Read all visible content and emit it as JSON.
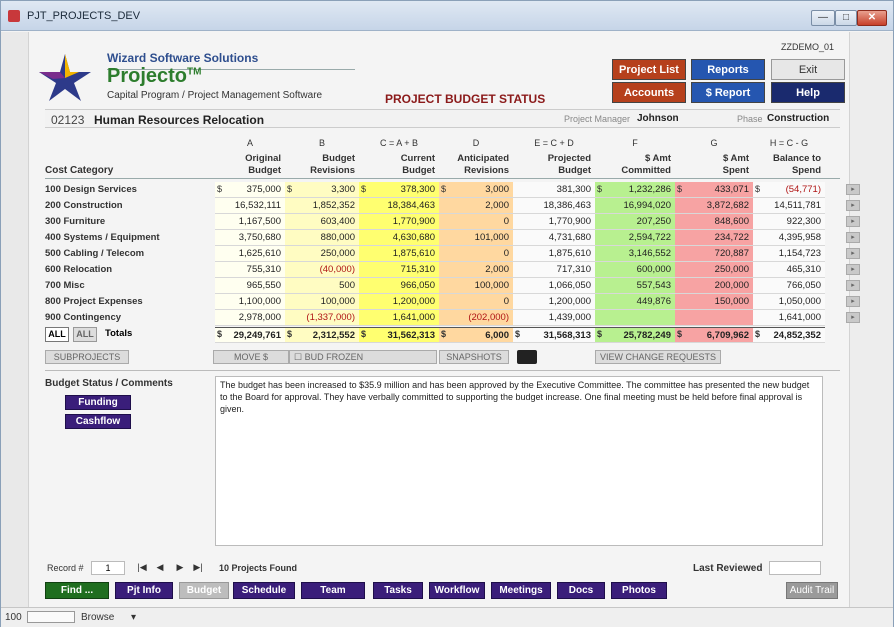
{
  "window": {
    "title": "PJT_PROJECTS_DEV"
  },
  "header": {
    "company": "Wizard Software Solutions",
    "brand": "Projecto",
    "brand_tm": "TM",
    "tagline": "Capital Program / Project Management Software",
    "page_title": "PROJECT BUDGET STATUS",
    "db_label": "ZZDEMO_01"
  },
  "nav": {
    "project_list": "Project List",
    "reports": "Reports",
    "exit": "Exit",
    "accounts": "Accounts",
    "s_report": "$ Report",
    "help": "Help"
  },
  "project": {
    "number": "02123",
    "name": "Human Resources Relocation",
    "pm_label": "Project Manager",
    "pm": "Johnson",
    "phase_label": "Phase",
    "phase": "Construction"
  },
  "columns": {
    "letters": [
      "A",
      "B",
      "C = A + B",
      "D",
      "E = C + D",
      "F",
      "G",
      "H = C - G"
    ],
    "headers": [
      [
        "Original",
        "Budget"
      ],
      [
        "Budget",
        "Revisions"
      ],
      [
        "Current",
        "Budget"
      ],
      [
        "Anticipated",
        "Revisions"
      ],
      [
        "Projected",
        "Budget"
      ],
      [
        "$ Amt",
        "Committed"
      ],
      [
        "$ Amt",
        "Spent"
      ],
      [
        "Balance to",
        "Spend"
      ]
    ],
    "cost_category": "Cost Category"
  },
  "rows": [
    {
      "cat": "100 Design Services",
      "a": "375,000",
      "b": "3,300",
      "c": "378,300",
      "d": "3,000",
      "e": "381,300",
      "f": "1,232,286",
      "g": "433,071",
      "h": "(54,771)"
    },
    {
      "cat": "200 Construction",
      "a": "16,532,111",
      "b": "1,852,352",
      "c": "18,384,463",
      "d": "2,000",
      "e": "18,386,463",
      "f": "16,994,020",
      "g": "3,872,682",
      "h": "14,511,781"
    },
    {
      "cat": "300 Furniture",
      "a": "1,167,500",
      "b": "603,400",
      "c": "1,770,900",
      "d": "0",
      "e": "1,770,900",
      "f": "207,250",
      "g": "848,600",
      "h": "922,300"
    },
    {
      "cat": "400 Systems / Equipment",
      "a": "3,750,680",
      "b": "880,000",
      "c": "4,630,680",
      "d": "101,000",
      "e": "4,731,680",
      "f": "2,594,722",
      "g": "234,722",
      "h": "4,395,958"
    },
    {
      "cat": "500 Cabling / Telecom",
      "a": "1,625,610",
      "b": "250,000",
      "c": "1,875,610",
      "d": "0",
      "e": "1,875,610",
      "f": "3,146,552",
      "g": "720,887",
      "h": "1,154,723"
    },
    {
      "cat": "600 Relocation",
      "a": "755,310",
      "b": "(40,000)",
      "c": "715,310",
      "d": "2,000",
      "e": "717,310",
      "f": "600,000",
      "g": "250,000",
      "h": "465,310"
    },
    {
      "cat": "700 Misc",
      "a": "965,550",
      "b": "500",
      "c": "966,050",
      "d": "100,000",
      "e": "1,066,050",
      "f": "557,543",
      "g": "200,000",
      "h": "766,050"
    },
    {
      "cat": "800 Project Expenses",
      "a": "1,100,000",
      "b": "100,000",
      "c": "1,200,000",
      "d": "0",
      "e": "1,200,000",
      "f": "449,876",
      "g": "150,000",
      "h": "1,050,000"
    },
    {
      "cat": "900 Contingency",
      "a": "2,978,000",
      "b": "(1,337,000)",
      "c": "1,641,000",
      "d": "(202,000)",
      "e": "1,439,000",
      "f": "",
      "g": "",
      "h": "1,641,000"
    }
  ],
  "totals": {
    "all1": "ALL",
    "all2": "ALL",
    "label": "Totals",
    "a": "29,249,761",
    "b": "2,312,552",
    "c": "31,562,313",
    "d": "6,000",
    "e": "31,568,313",
    "f": "25,782,249",
    "g": "6,709,962",
    "h": "24,852,352"
  },
  "dollar_sign": "$",
  "actions": {
    "subprojects": "SUBPROJECTS",
    "move": "MOVE $",
    "bud_frozen": "BUD FROZEN",
    "snapshots": "SNAPSHOTS",
    "view_change": "VIEW CHANGE REQUESTS"
  },
  "comments": {
    "label": "Budget Status / Comments",
    "funding": "Funding",
    "cashflow": "Cashflow",
    "text": "The budget has been increased to $35.9 million and has been approved by the Executive Committee.  The committee  has presented the new budget to the Board for approval. They have verbally committed to supporting the budget increase. One final meeting must be held before final approval is given."
  },
  "footer": {
    "record_label": "Record #",
    "record": "1",
    "found": "10 Projects Found",
    "last_reviewed": "Last Reviewed"
  },
  "tabs": [
    "Find ...",
    "Pjt Info",
    "Budget",
    "Schedule",
    "Team",
    "Tasks",
    "Workflow",
    "Meetings",
    "Docs",
    "Photos"
  ],
  "audit": "Audit Trail",
  "status": {
    "zoom": "100",
    "mode": "Browse"
  }
}
